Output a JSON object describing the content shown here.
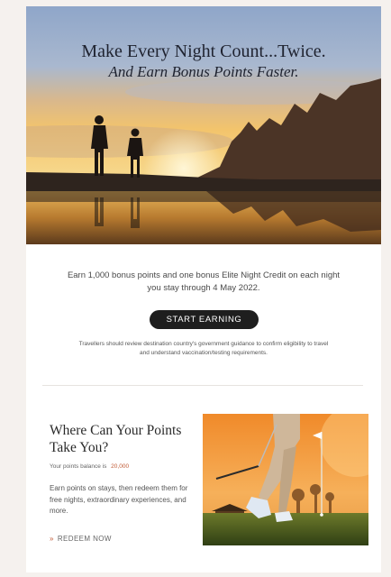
{
  "hero": {
    "headline": "Make Every Night Count...Twice.",
    "subheadline": "And Earn Bonus Points Faster."
  },
  "offer": {
    "text": "Earn 1,000 bonus points and one bonus Elite Night Credit on each night you stay through 4 May 2022.",
    "cta_label": "START EARNING",
    "disclaimer": "Travellers should review destination country's government guidance to confirm eligibility to travel and understand vaccination/testing requirements."
  },
  "rewards": {
    "title": "Where Can Your Points Take You?",
    "balance_label": "Your points balance is",
    "balance_value": "20,000",
    "description": "Earn points on stays, then redeem them for free nights, extraordinary experiences, and more.",
    "link_icon": "double-chevron-right-icon",
    "link_label": "REDEEM NOW"
  },
  "colors": {
    "page_bg": "#f5f1ee",
    "accent": "#c05a35",
    "button": "#1e1e1e"
  }
}
